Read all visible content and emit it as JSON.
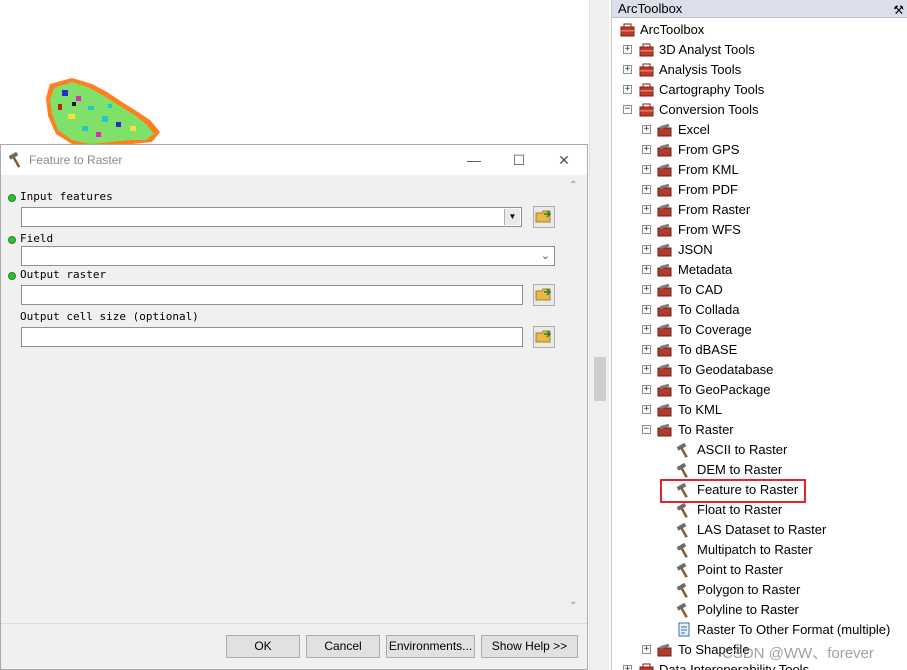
{
  "dialog": {
    "title": "Feature to Raster",
    "params": [
      {
        "label": "Input features",
        "required": true,
        "value": ""
      },
      {
        "label": "Field",
        "required": true,
        "value": ""
      },
      {
        "label": "Output raster",
        "required": true,
        "value": ""
      },
      {
        "label": "Output cell size (optional)",
        "required": false,
        "value": ""
      }
    ],
    "buttons": {
      "ok": "OK",
      "cancel": "Cancel",
      "environments": "Environments...",
      "show_help": "Show Help >>"
    }
  },
  "toolbox": {
    "panel_title": "ArcToolbox",
    "root": "ArcToolbox",
    "toolboxes": [
      {
        "label": "3D Analyst Tools",
        "expanded": false
      },
      {
        "label": "Analysis Tools",
        "expanded": false
      },
      {
        "label": "Cartography Tools",
        "expanded": false
      },
      {
        "label": "Conversion Tools",
        "expanded": true
      }
    ],
    "conversion_toolsets": [
      "Excel",
      "From GPS",
      "From KML",
      "From PDF",
      "From Raster",
      "From WFS",
      "JSON",
      "Metadata",
      "To CAD",
      "To Collada",
      "To Coverage",
      "To dBASE",
      "To Geodatabase",
      "To GeoPackage",
      "To KML",
      "To Raster"
    ],
    "to_raster_tools": [
      "ASCII to Raster",
      "DEM to Raster",
      "Feature to Raster",
      "Float to Raster",
      "LAS Dataset to Raster",
      "Multipatch to Raster",
      "Point to Raster",
      "Polygon to Raster",
      "Polyline to Raster",
      "Raster To Other Format (multiple)"
    ],
    "after": [
      "To Shapefile",
      "Data Interoperability Tools"
    ],
    "selected_tool": "Feature to Raster"
  },
  "watermark": "CSDN @WW、forever",
  "colors": {
    "highlight": "#e0262a",
    "required_dot": "#2fbf2f",
    "toolbox_red": "#c0392b"
  }
}
